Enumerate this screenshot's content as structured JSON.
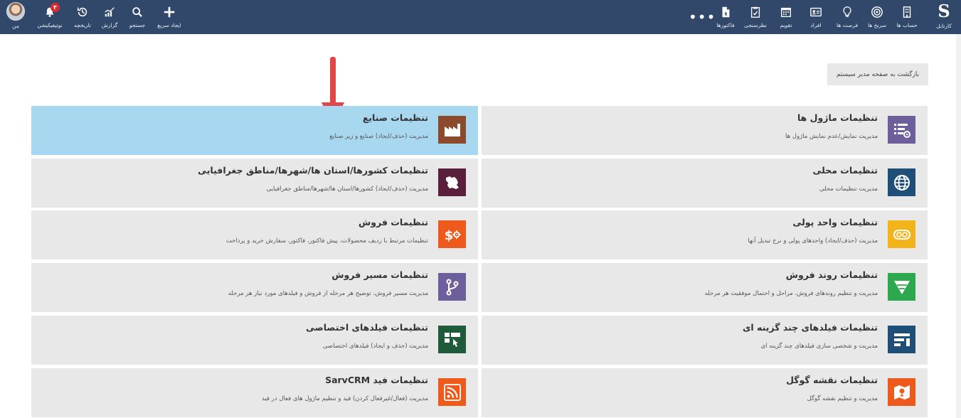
{
  "topbar": {
    "logo_letter": "S",
    "right_items": [
      {
        "label": "کارتابل",
        "icon": "logo-s"
      },
      {
        "label": "حساب ها",
        "icon": "building-icon"
      },
      {
        "label": "سرنخ ها",
        "icon": "target-icon"
      },
      {
        "label": "فرصت ها",
        "icon": "lightbulb-icon"
      },
      {
        "label": "افراد",
        "icon": "id-card-icon"
      },
      {
        "label": "تقویم",
        "icon": "calendar-icon"
      },
      {
        "label": "نظرسنجی",
        "icon": "survey-icon"
      },
      {
        "label": "فاکتورها",
        "icon": "invoice-icon"
      }
    ],
    "more_label": "•••",
    "left_items": [
      {
        "label": "ایجاد سریع",
        "icon": "plus-icon"
      },
      {
        "label": "جستجو",
        "icon": "search-icon"
      },
      {
        "label": "گزارش",
        "icon": "chart-icon"
      },
      {
        "label": "تاریخچه",
        "icon": "history-icon"
      },
      {
        "label": "نوتیفیکیشن",
        "icon": "bell-icon",
        "badge": "۴"
      },
      {
        "label": "من",
        "icon": "avatar"
      }
    ]
  },
  "back_button": "بازگشت به صفحه مدیر سیستم",
  "cards": [
    {
      "title": "تنظیمات ماژول ها",
      "desc": "مدیریت نمایش/عدم نمایش ماژول ها",
      "icon": "module-settings-icon",
      "color": "#6c5f9c"
    },
    {
      "title": "تنظیمات صنایع",
      "desc": "مدیریت (حذف/ایجاد) صنایع و زیر صنایع",
      "icon": "factory-icon",
      "color": "#8b4a2b",
      "highlight": true
    },
    {
      "title": "تنظیمات محلی",
      "desc": "مدیریت تنظیمات محلی",
      "icon": "globe-icon",
      "color": "#1f4e79"
    },
    {
      "title": "تنظیمات کشورها/استان ها/شهرها/مناطق جغرافیایی",
      "desc": "مدیریت (حذف/ایجاد) کشورها/استان ها/شهرها/مناطق جغرافیایی",
      "icon": "iran-map-icon",
      "color": "#5a1f3d"
    },
    {
      "title": "تنظیمات واحد پولی",
      "desc": "مدیریت (حذف/ایجاد) واحدهای پولی و نرخ تبدیل آنها",
      "icon": "currency-icon",
      "color": "#f2b31b"
    },
    {
      "title": "تنظیمات فروش",
      "desc": "تنظیمات مرتبط با ردیف محصولات، پیش فاکتور، فاکتور، سفارش خرید و پرداخت",
      "icon": "sales-settings-icon",
      "color": "#ee5a1c"
    },
    {
      "title": "تنظیمات روند فروش",
      "desc": "مدیریت و تنظیم روندهای فروش، مراحل و احتمال موفقیت هر مرحله",
      "icon": "funnel-icon",
      "color": "#2ea84f"
    },
    {
      "title": "تنظیمات مسیر فروش",
      "desc": "مدیریت مسیر فروش، توضیح هر مرحله از فروش و فیلدهای مورد نیاز هر مرحله",
      "icon": "branch-icon",
      "color": "#6c5f9c"
    },
    {
      "title": "تنظیمات فیلدهای چند گزینه ای",
      "desc": "مدیریت و شخصی سازی فیلدهای چند گزینه ای",
      "icon": "picklist-icon",
      "color": "#1f4e79"
    },
    {
      "title": "تنظیمات فیلدهای اختصاصی",
      "desc": "مدیریت (حذف و ایجاد) فیلدهای اختصاصی",
      "icon": "custom-fields-icon",
      "color": "#1f5a3a"
    },
    {
      "title": "تنظیمات نقشه گوگل",
      "desc": "مدیریت و تنظیم نقشه گوگل",
      "icon": "map-icon",
      "color": "#ee5a1c"
    },
    {
      "title": "تنظیمات فید SarvCRM",
      "desc": "مدیریت (فعال/غیرفعال کردن) فید و تنظیم ماژول های فعال در فید",
      "icon": "rss-icon",
      "color": "#ee5a1c"
    }
  ]
}
